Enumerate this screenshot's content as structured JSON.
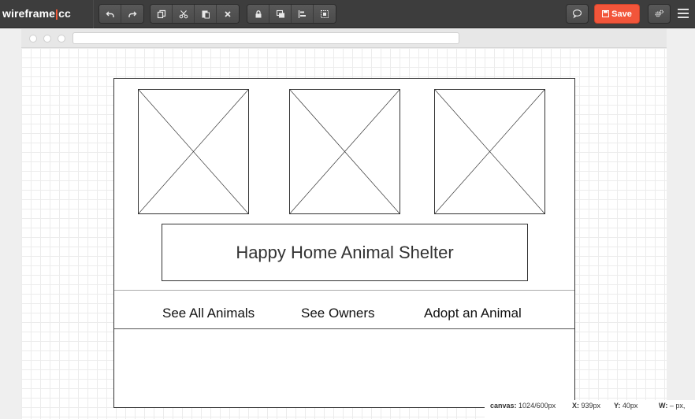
{
  "app": {
    "logo_left": "wireframe",
    "logo_sep": "|",
    "logo_right": "cc"
  },
  "toolbar": {
    "undo_icon": "undo-icon",
    "redo_icon": "redo-icon",
    "copy_icon": "copy-icon",
    "cut_icon": "scissors-icon",
    "paste_icon": "paste-icon",
    "delete_icon": "close-icon",
    "lock_icon": "lock-icon",
    "arrange_icon": "arrange-icon",
    "align_icon": "align-left-icon",
    "group_icon": "group-icon",
    "comment_icon": "speech-bubble-icon",
    "save_label": "Save",
    "settings_icon": "gears-icon",
    "menu_icon": "hamburger-menu-icon",
    "accent_color": "#f2553a"
  },
  "browser": {
    "url": ""
  },
  "wireframe": {
    "title": "Happy Home Animal Shelter",
    "nav": [
      "See All Animals",
      "See Owners",
      "Adopt an Animal"
    ],
    "image_placeholders": 3
  },
  "status": {
    "canvas_label": "canvas:",
    "canvas_value": "1024/600px",
    "x_label": "X:",
    "x_value": "939px",
    "y_label": "Y:",
    "y_value": "40px",
    "w_label": "W:",
    "w_value": "– px,"
  }
}
